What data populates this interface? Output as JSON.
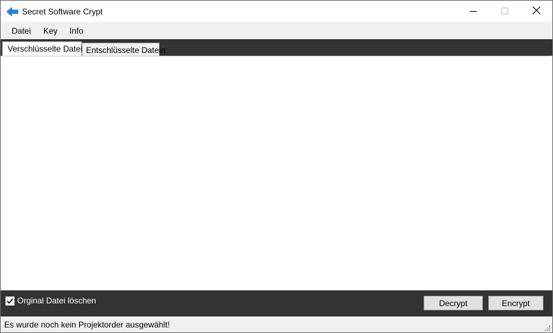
{
  "window": {
    "title": "Secret Software Crypt"
  },
  "icons": {
    "app": "back-arrow-icon",
    "minimize": "minimize-icon",
    "maximize": "maximize-icon",
    "close": "close-icon",
    "checkbox": "checkmark-icon",
    "grip": "resize-grip-icon"
  },
  "menu": {
    "items": [
      "Datei",
      "Key",
      "Info"
    ]
  },
  "tabs": [
    {
      "label": "Verschlüsselte Datein",
      "active": true
    },
    {
      "label": "Entschlüsselte Datein",
      "active": false
    }
  ],
  "options": {
    "delete_original_label": "Orginal Datei löschen",
    "delete_original_checked": true
  },
  "buttons": {
    "decrypt": "Decrypt",
    "encrypt": "Encrypt"
  },
  "status": {
    "text": "Es wurde noch kein Projektorder ausgewählt!"
  },
  "colors": {
    "dark_bar": "#333333",
    "accent_icon": "#1e88e5",
    "menu_bg": "#f0f0f0"
  }
}
